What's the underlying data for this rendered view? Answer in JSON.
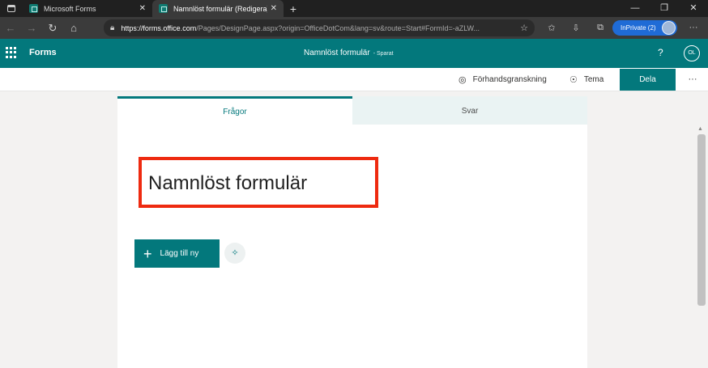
{
  "browser": {
    "tabs": [
      {
        "title": "Microsoft Forms",
        "close": "✕"
      },
      {
        "title": "Namnlöst formulär (Redigera) M",
        "close": "✕"
      }
    ],
    "new_tab": "+",
    "window_controls": [
      "—",
      "❐",
      "✕"
    ],
    "url_host": "https://forms.office.com",
    "url_rest": "/Pages/DesignPage.aspx?origin=OfficeDotCom&lang=sv&route=Start#FormId=-aZLW...",
    "inprivate": "InPrivate (2)",
    "more": "···"
  },
  "forms_header": {
    "app_name": "Forms",
    "form_title": "Namnlöst formulär",
    "save_status": "- Sparat",
    "help": "?",
    "user_initials": "OL"
  },
  "command_bar": {
    "preview_label": "Förhandsgranskning",
    "theme_label": "Tema",
    "share_label": "Dela",
    "more": "···"
  },
  "form_tabs": {
    "questions": "Frågor",
    "responses": "Svar"
  },
  "form": {
    "title": "Namnlöst formulär",
    "add_new_label": "Lägg till ny"
  },
  "colors": {
    "brand": "#03787c",
    "highlight_box": "#ee2a10",
    "inprivate": "#1f6bd6"
  },
  "icons": [
    "window-icon",
    "forms-favicon",
    "back-arrow-icon",
    "forward-arrow-icon",
    "refresh-icon",
    "home-icon",
    "lock-icon",
    "favorite-star-icon",
    "favorites-icon",
    "extensions-icon",
    "collections-icon",
    "waffle-icon",
    "eye-icon",
    "palette-icon",
    "plus-icon",
    "lightbulb-icon"
  ]
}
